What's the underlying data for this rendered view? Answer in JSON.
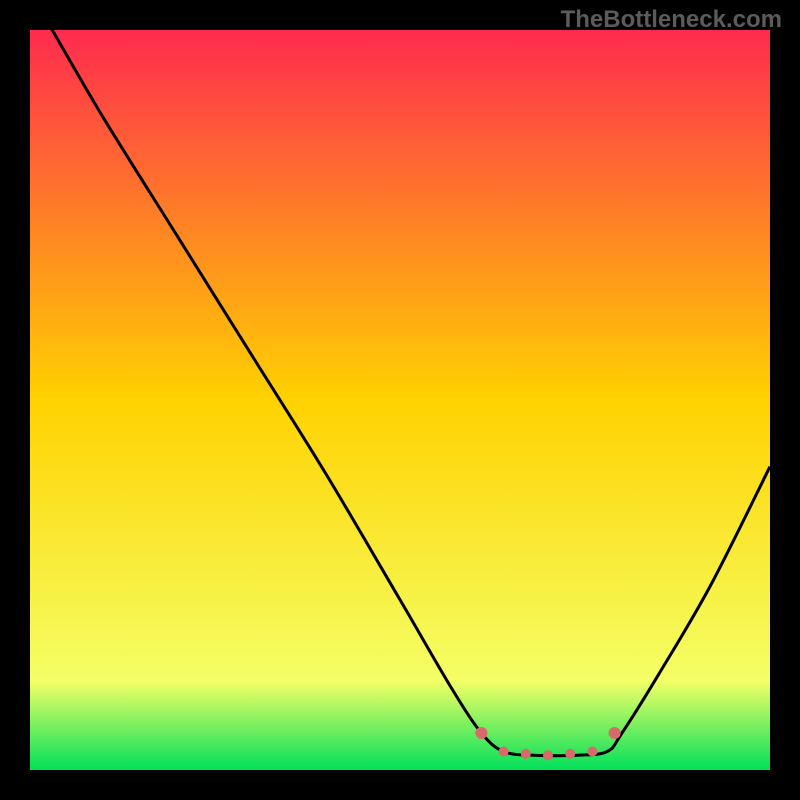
{
  "watermark": "TheBottleneck.com",
  "chart_data": {
    "type": "line",
    "title": "",
    "xlabel": "",
    "ylabel": "",
    "xlim": [
      0,
      100
    ],
    "ylim": [
      0,
      100
    ],
    "background_gradient": {
      "stops": [
        {
          "offset": 0,
          "color": "#ff2b4e"
        },
        {
          "offset": 50,
          "color": "#ffd200"
        },
        {
          "offset": 88,
          "color": "#f4ff66"
        },
        {
          "offset": 100,
          "color": "#00e05a"
        }
      ]
    },
    "curve": {
      "x": [
        0,
        3,
        10,
        20,
        30,
        40,
        50,
        57,
        61,
        64,
        68,
        74,
        78,
        80,
        85,
        92,
        100
      ],
      "y": [
        105,
        100,
        88,
        72,
        56,
        40,
        23,
        11,
        5,
        2.5,
        2,
        2,
        2.5,
        5,
        13,
        25,
        41
      ]
    },
    "optimal_markers": {
      "x": [
        61,
        64,
        67,
        70,
        73,
        76,
        79
      ],
      "y": [
        5,
        2.5,
        2.2,
        2,
        2.2,
        2.5,
        5
      ],
      "color": "#d86a6a"
    }
  }
}
